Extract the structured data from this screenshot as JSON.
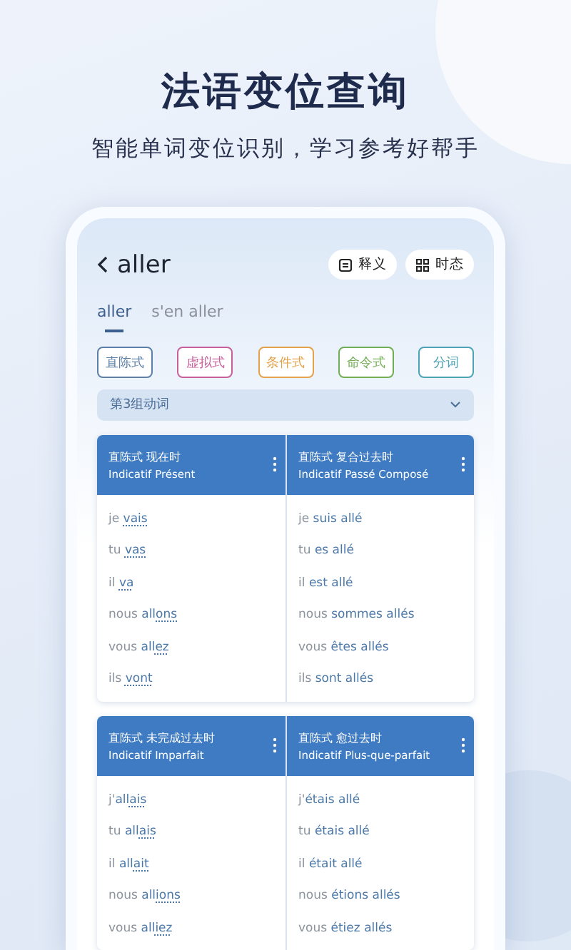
{
  "headline": "法语变位查询",
  "tagline": "智能单词变位识别，学习参考好帮手",
  "app": {
    "verb": "aller",
    "actions": [
      {
        "kind": "list",
        "label": "释义"
      },
      {
        "kind": "grid",
        "label": "时态"
      }
    ],
    "tabs": [
      {
        "label": "aller",
        "selected": true
      },
      {
        "label": "s'en aller",
        "selected": false
      }
    ],
    "moods": [
      {
        "label": "直陈式",
        "color": "#5b7fa6"
      },
      {
        "label": "虚拟式",
        "color": "#c7609a"
      },
      {
        "label": "条件式",
        "color": "#e3a24a"
      },
      {
        "label": "命令式",
        "color": "#70ad55"
      },
      {
        "label": "分词",
        "color": "#4ba3b5"
      }
    ],
    "group": {
      "value": "第3组动词",
      "expanded": false
    },
    "tense_cards": [
      {
        "tenses": [
          {
            "title_zh": "直陈式 现在时",
            "title_fr": "Indicatif Présent",
            "forms": [
              {
                "pronoun": "je",
                "ending": "vais"
              },
              {
                "pronoun": "tu",
                "ending": "vas"
              },
              {
                "pronoun": "il",
                "ending": "va"
              },
              {
                "pronoun": "nous",
                "stem": "all",
                "ending": "ons"
              },
              {
                "pronoun": "vous",
                "stem": "all",
                "ending": "ez"
              },
              {
                "pronoun": "ils",
                "ending": "vont"
              }
            ]
          },
          {
            "title_zh": "直陈式 复合过去时",
            "title_fr": "Indicatif Passé Composé",
            "forms": [
              {
                "pronoun": "je",
                "stem": "suis allé"
              },
              {
                "pronoun": "tu",
                "stem": "es allé"
              },
              {
                "pronoun": "il",
                "stem": "est allé"
              },
              {
                "pronoun": "nous",
                "stem": "sommes allés"
              },
              {
                "pronoun": "vous",
                "stem": "êtes allés"
              },
              {
                "pronoun": "ils",
                "stem": "sont allés"
              }
            ]
          }
        ]
      },
      {
        "tenses": [
          {
            "title_zh": "直陈式 未完成过去时",
            "title_fr": "Indicatif Imparfait",
            "forms": [
              {
                "pronoun": "j'",
                "stem": "all",
                "ending": "ais"
              },
              {
                "pronoun": "tu",
                "stem": "all",
                "ending": "ais"
              },
              {
                "pronoun": "il",
                "stem": "all",
                "ending": "ait"
              },
              {
                "pronoun": "nous",
                "stem": "all",
                "ending": "ions"
              },
              {
                "pronoun": "vous",
                "stem": "all",
                "ending": "iez"
              }
            ]
          },
          {
            "title_zh": "直陈式 愈过去时",
            "title_fr": "Indicatif Plus-que-parfait",
            "forms": [
              {
                "pronoun": "j'",
                "stem": "étais allé"
              },
              {
                "pronoun": "tu",
                "stem": "étais allé"
              },
              {
                "pronoun": "il",
                "stem": "était allé"
              },
              {
                "pronoun": "nous",
                "stem": "étions allés"
              },
              {
                "pronoun": "vous",
                "stem": "étiez allés"
              }
            ]
          }
        ]
      }
    ]
  }
}
